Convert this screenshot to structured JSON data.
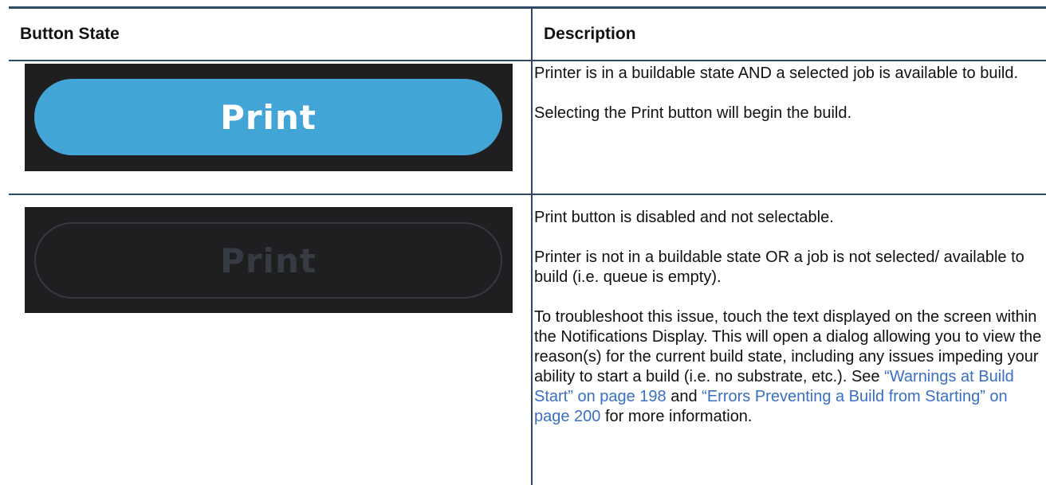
{
  "table": {
    "headers": {
      "button_state": "Button State",
      "description": "Description"
    },
    "rows": [
      {
        "button": {
          "label": "Print",
          "state": "enabled",
          "fill_color": "#42a5d6",
          "panel_color": "#1f1e21"
        },
        "paragraphs": [
          "Printer is in a buildable state AND a selected job is available to build.",
          "Selecting the Print button will begin the build."
        ]
      },
      {
        "button": {
          "label": "Print",
          "state": "disabled",
          "outline_color": "#353a41",
          "panel_color": "#1f1e21"
        },
        "paragraphs": [
          "Print button is disabled and not selectable.",
          "Printer is not in a buildable state OR a job is not selected/ available to build (i.e. queue is empty)."
        ],
        "troubleshoot": {
          "text_1": "To troubleshoot this issue, touch the text displayed on the screen within the Notifications Display. This will open a dialog allowing you to view the reason(s) for the current build state, including any issues impeding your ability to start a build (i.e. no substrate, etc.). See ",
          "link_1": "“Warnings at Build Start” on page 198",
          "text_2": " and ",
          "link_2": "“Errors Preventing a Build from Starting” on page 200",
          "text_3": " for more information."
        }
      }
    ]
  },
  "colors": {
    "rule": "#2f4a66",
    "link": "#3a6fc4"
  }
}
